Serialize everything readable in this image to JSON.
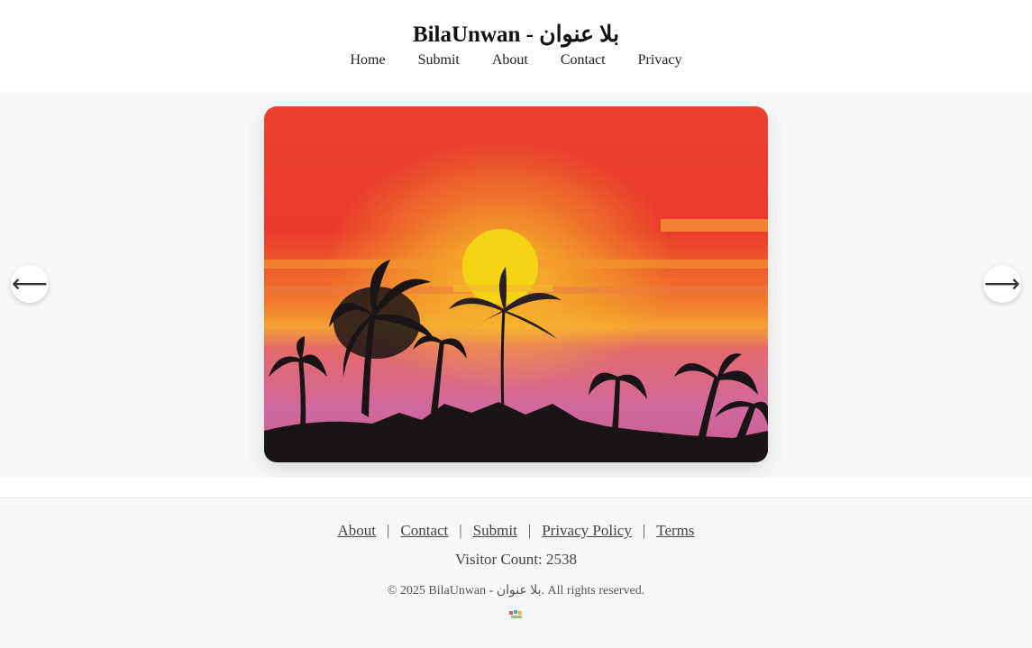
{
  "site": {
    "title": "BilaUnwan - بلا عنوان"
  },
  "nav": {
    "items": [
      "Home",
      "Submit",
      "About",
      "Contact",
      "Privacy"
    ]
  },
  "carousel": {
    "prev_icon": "arrow-left-icon",
    "next_icon": "arrow-right-icon",
    "prev_glyph": "⟵",
    "next_glyph": "⟶"
  },
  "artwork": {
    "subject": "sunset-palm-drawing"
  },
  "footer": {
    "links": [
      "About",
      "Contact",
      "Submit",
      "Privacy Policy",
      "Terms"
    ],
    "separator": "|",
    "visitor_label": "Visitor Count: 2538",
    "copyright": "© 2025 BilaUnwan - بلا عنوان. All rights reserved."
  },
  "colors": {
    "sky_top": "#e8432e",
    "sun": "#f2d414",
    "water": "#d0699e",
    "silhouette": "#1a1416"
  }
}
